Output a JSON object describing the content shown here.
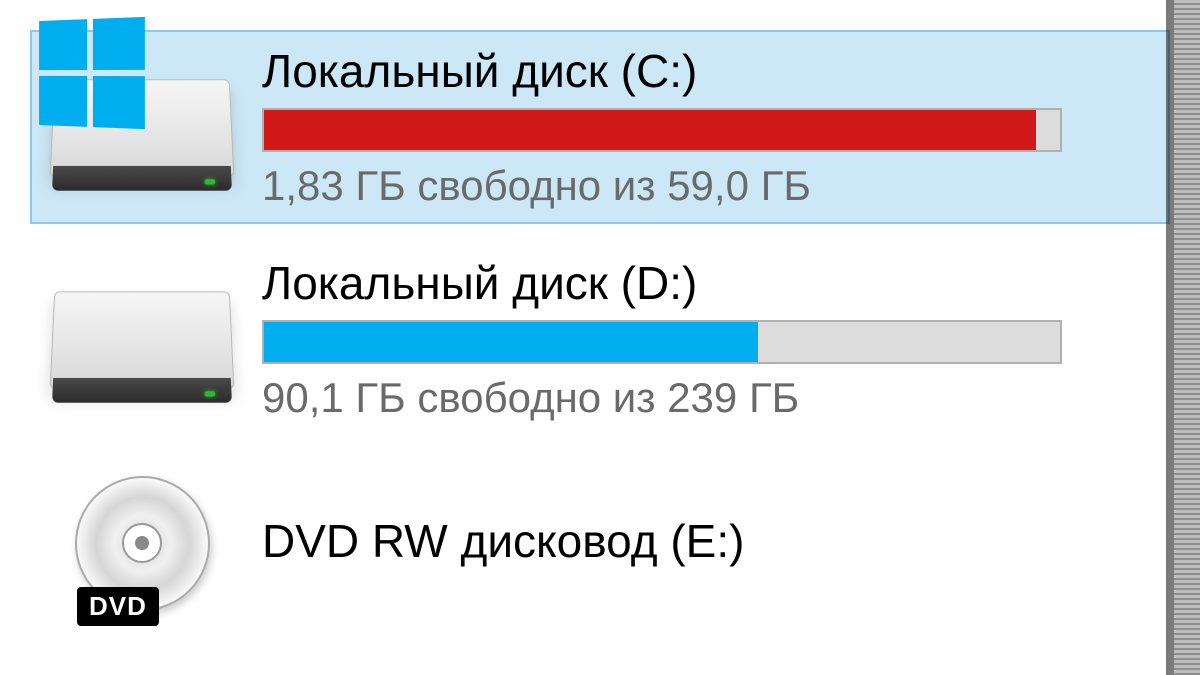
{
  "drives": [
    {
      "label": "Локальный диск (C:)",
      "status": "1,83 ГБ свободно из 59,0 ГБ",
      "fill_percent": 97,
      "fill_color": "#d21919",
      "selected": true,
      "has_winlogo": true,
      "type": "hdd"
    },
    {
      "label": "Локальный диск (D:)",
      "status": "90,1 ГБ свободно из 239 ГБ",
      "fill_percent": 62,
      "fill_color": "#00adef",
      "selected": false,
      "has_winlogo": false,
      "type": "hdd"
    },
    {
      "label": "DVD RW дисковод (E:)",
      "status": "",
      "fill_percent": 0,
      "fill_color": "",
      "selected": false,
      "has_winlogo": false,
      "type": "dvd"
    }
  ],
  "dvd_badge": "DVD"
}
